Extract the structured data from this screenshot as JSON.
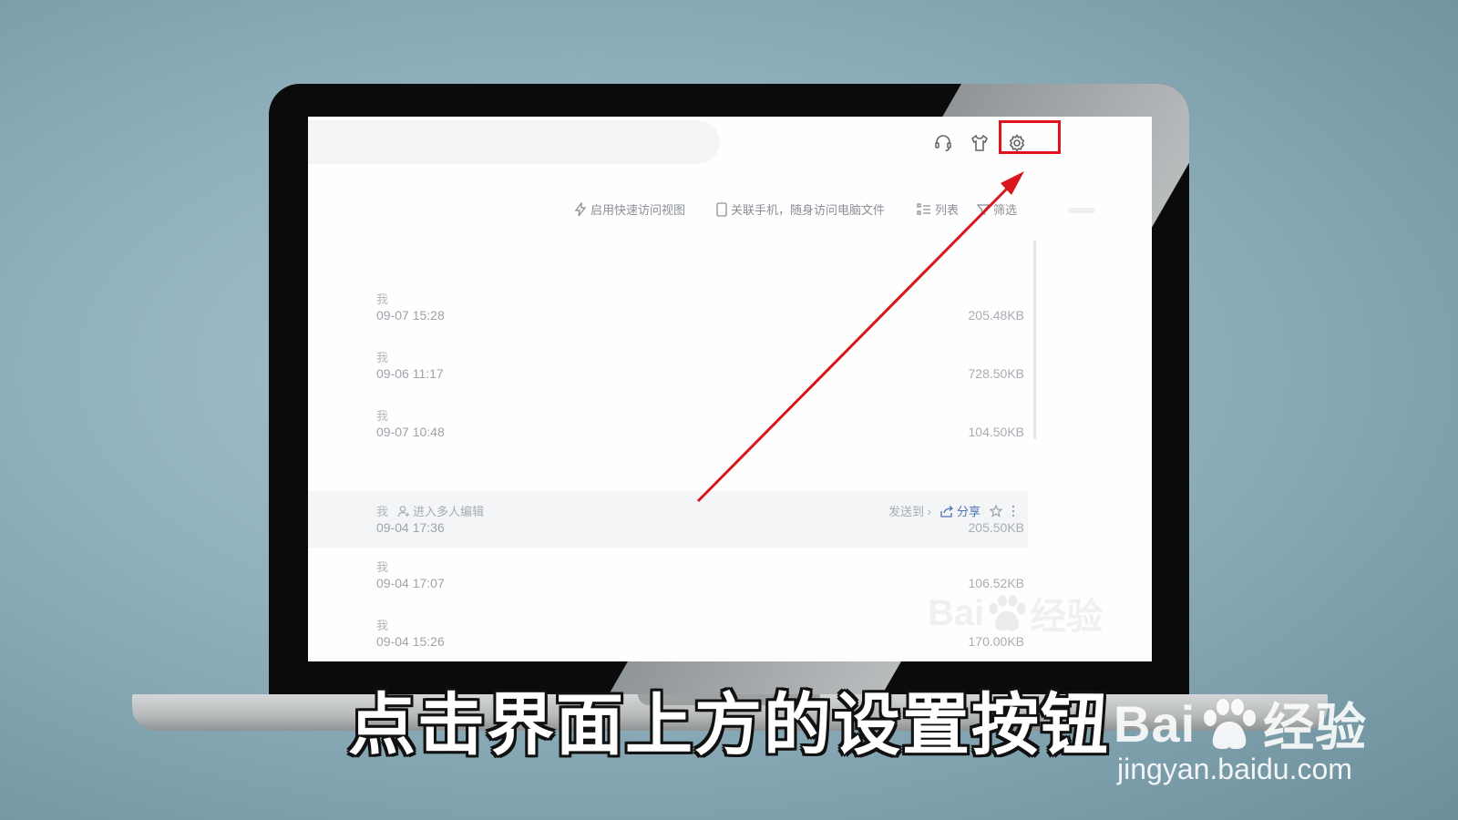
{
  "app": {
    "toolbar": {
      "quick_access": "启用快速访问视图",
      "link_phone": "关联手机，随身访问电脑文件",
      "list": "列表",
      "filter": "筛选"
    },
    "top_icons": [
      "headset-icon",
      "shirt-icon",
      "gear-icon"
    ],
    "files": [
      {
        "owner": "我",
        "time": "09-07 15:28",
        "size": "205.48KB"
      },
      {
        "owner": "我",
        "time": "09-06 11:17",
        "size": "728.50KB"
      },
      {
        "owner": "我",
        "time": "09-07 10:48",
        "size": "104.50KB"
      },
      {
        "owner": "我",
        "time": "09-04 17:36",
        "size": "205.50KB",
        "multi_edit": "进入多人编辑",
        "send_to": "发送到 ›",
        "share": "分享"
      },
      {
        "owner": "我",
        "time": "09-04 17:07",
        "size": "106.52KB"
      },
      {
        "owner": "我",
        "time": "09-04 15:26",
        "size": "170.00KB"
      }
    ]
  },
  "caption": "点击界面上方的设置按钮",
  "watermark": {
    "logo_left": "Bai",
    "logo_right": "经验",
    "url": "jingyan.baidu.com"
  },
  "colors": {
    "highlight": "#e0141c",
    "arrow": "#d9161c",
    "share": "#4a74b6"
  }
}
